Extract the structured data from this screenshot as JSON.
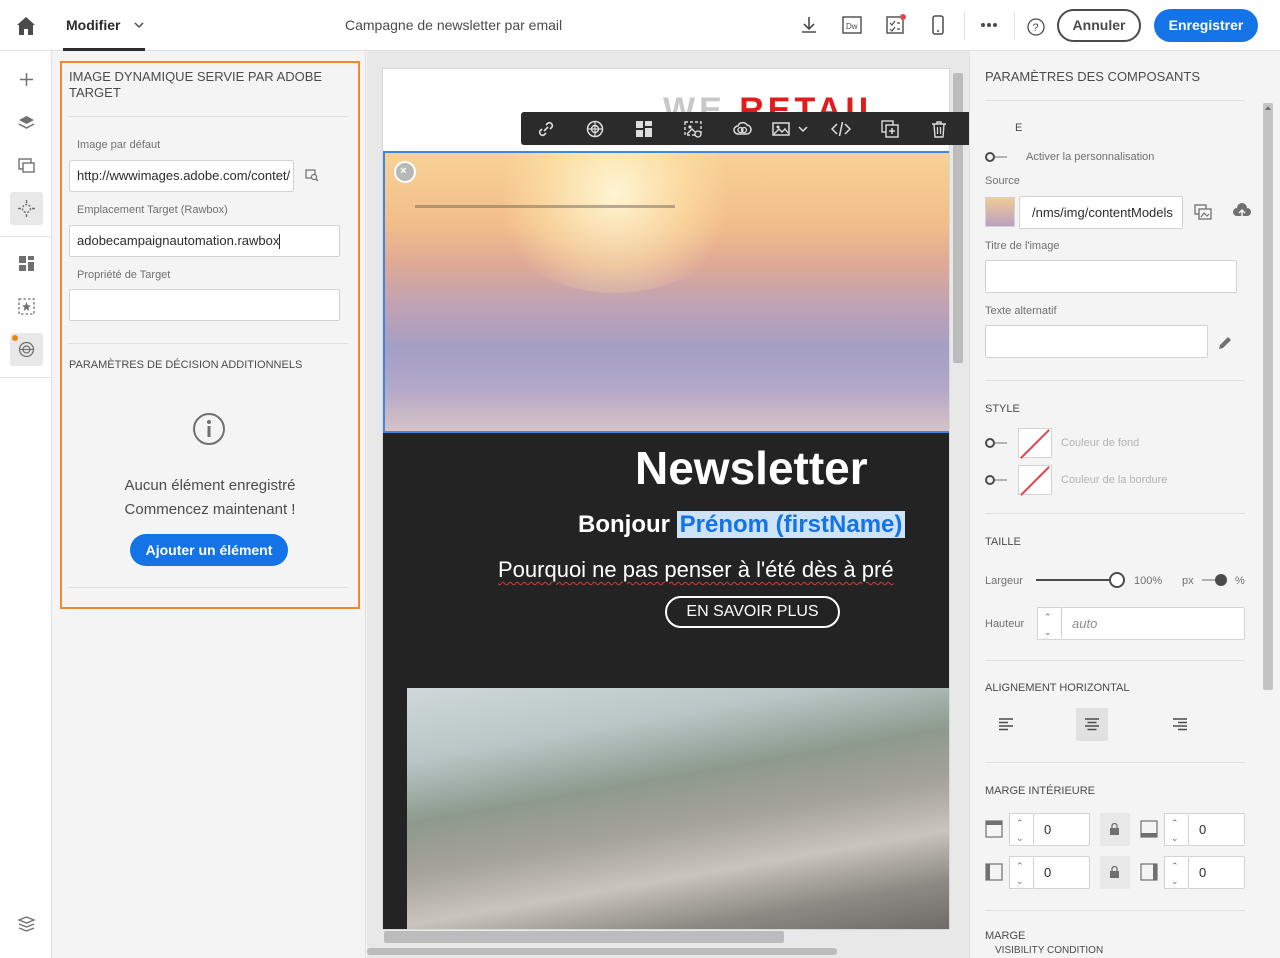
{
  "topbar": {
    "modifier_label": "Modifier",
    "document_title": "Campagne de newsletter par email",
    "cancel_label": "Annuler",
    "save_label": "Enregistrer",
    "icons": [
      "home-icon",
      "download-icon",
      "dreamweaver-icon",
      "checklist-icon",
      "mobile-preview-icon",
      "more-icon",
      "help-icon"
    ]
  },
  "left_rail": {
    "items": [
      "add-icon",
      "layers-icon",
      "assets-icon",
      "fragments-icon",
      "structure-icon",
      "personalization-icon",
      "target-icon",
      "settings-icon"
    ],
    "accent_color": "#e68619"
  },
  "target_panel": {
    "title": "IMAGE DYNAMIQUE SERVIE PAR ADOBE TARGET",
    "default_image_label": "Image par défaut",
    "default_image_value": "http://wwwimages.adobe.com/contet/",
    "location_label": "Emplacement Target (Rawbox)",
    "location_value": "adobecampaignautomation.rawbox",
    "property_label": "Propriété de Target",
    "property_value": "",
    "decision_title": "PARAMÈTRES DE DÉCISION ADDITIONNELS",
    "empty_line1": "Aucun élément enregistré",
    "empty_line2": "Commencez maintenant !",
    "add_button": "Ajouter un élément",
    "highlight_color": "#f0882f"
  },
  "email": {
    "logo_we": "WE",
    "logo_retail": "RETAIL",
    "newsletter_title": "Newsletter",
    "greeting": "Bonjour",
    "firstname_field": "Prénom (firstName)",
    "tagline": "Pourquoi ne pas penser à l'été dès à pré",
    "cta_label": "EN SAVOIR PLUS"
  },
  "floating_toolbar": {
    "icons": [
      "link-icon",
      "target-icon",
      "layout-icon",
      "image-settings-icon",
      "creative-cloud-icon",
      "image-icon",
      "chevron-down-icon",
      "code-icon",
      "duplicate-icon",
      "delete-icon",
      "select-parent-icon"
    ]
  },
  "components_panel": {
    "title": "PARAMÈTRES DES COMPOSANTS",
    "partial_section": "E",
    "personalize_label": "Activer la personnalisation",
    "source_label": "Source",
    "source_value": "/nms/img/contentModels",
    "image_title_label": "Titre de l'image",
    "alt_text_label": "Texte alternatif",
    "style_section": "STYLE",
    "bg_color_label": "Couleur de fond",
    "border_color_label": "Couleur de la bordure",
    "size_section": "TAILLE",
    "width_label": "Largeur",
    "width_value": "100%",
    "width_unit_px": "px",
    "width_unit_percent": "%",
    "width_percent_value": 100,
    "height_label": "Hauteur",
    "height_placeholder": "auto",
    "align_section": "ALIGNEMENT HORIZONTAL",
    "align_active": "center",
    "padding_section": "MARGE INTÉRIEURE",
    "padding_top": "0",
    "padding_bottom": "0",
    "padding_left": "0",
    "padding_right": "0",
    "margin_section": "MARGE",
    "visibility_section": "VISIBILITY CONDITION"
  }
}
